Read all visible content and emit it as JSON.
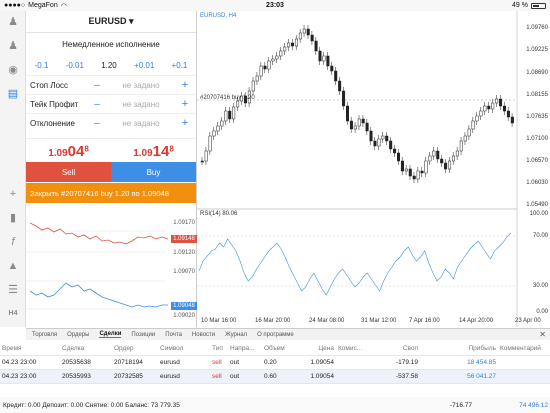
{
  "status": {
    "carrier": "MegaFon",
    "time": "23:03",
    "battery": "49 %"
  },
  "rail_icons": [
    "person-icon",
    "people-icon",
    "chat-icon",
    "new-order-icon",
    "crosshair-icon",
    "candles-icon",
    "function-icon",
    "objects-icon",
    "chart-type-icon",
    "timeframe-icon"
  ],
  "timeframe": "H4",
  "panel": {
    "symbol": "EURUSD ▾",
    "execution": "Немедленное исполнение",
    "volume_steps": [
      "-0.1",
      "-0.01",
      "1.20",
      "+0.01",
      "+0.1"
    ],
    "fields": [
      {
        "label": "Стоп Лосс",
        "value": "не задано"
      },
      {
        "label": "Тейк Профит",
        "value": "не задано"
      },
      {
        "label": "Отклонение",
        "value": "не задано"
      }
    ],
    "sell_price": {
      "main": "1.09",
      "big": "04",
      "sup": "8"
    },
    "buy_price": {
      "main": "1.09",
      "big": "14",
      "sup": "8"
    },
    "sell_label": "Sell",
    "buy_label": "Buy",
    "close_label": "Закрыть #20707416 buy 1.20 по 1.09048",
    "mini_ticks_top": [
      "1.09170",
      "1.09148",
      "1.09120"
    ],
    "mini_ticks_bottom": [
      "1.09070",
      "1.09048",
      "1.09020"
    ]
  },
  "chart": {
    "symbol_label": "EURUSD, H4",
    "order_label": "#20707416 buy 1.20",
    "price_ticks": [
      "1.09760",
      "1.09225",
      "1.08690",
      "1.08155",
      "1.07635",
      "1.07100",
      "1.06570",
      "1.06030",
      "1.05490"
    ],
    "rsi_label": "RSI(14) 80.06",
    "rsi_ticks": [
      "100.00",
      "70.00",
      "30.00",
      "0.00"
    ],
    "dates": [
      "10 Mar 16:00",
      "16 Mar 20:00",
      "24 Mar 08:00",
      "31 Mar 12:00",
      "7 Apr 16:00",
      "14 Apr 20:00",
      "23 Apr 00"
    ]
  },
  "tabs": [
    "Торговля",
    "Ордеры",
    "Сделки",
    "Позиции",
    "Почта",
    "Новости",
    "Журнал",
    "О программе"
  ],
  "active_tab": "Сделки",
  "table": {
    "headers": [
      "Время",
      "Сделка",
      "Ордер",
      "Символ",
      "Тип",
      "Напра...",
      "Объем",
      "Цена",
      "Комис...",
      "Своп",
      "Прибыль",
      "Комментарий"
    ],
    "rows": [
      [
        "04.23 23:00",
        "20535638",
        "20718194",
        "eurusd",
        "sell",
        "out",
        "0.20",
        "1.09054",
        "",
        "-179.19",
        "18 454.85",
        ""
      ],
      [
        "04.23 23:00",
        "20535993",
        "20732585",
        "eurusd",
        "sell",
        "out",
        "0.60",
        "1.09054",
        "",
        "-537.58",
        "56 041.27",
        ""
      ]
    ],
    "footer_text": "Кредит: 0.00 Депозит: 0.00 Снятие: 0.00 Баланс: 73 779.35",
    "footer_swap": "-716.77",
    "footer_profit": "74 496.12"
  },
  "colors": {
    "sell": "#e0523f",
    "buy": "#3f8ee6",
    "close": "#f0900e",
    "accent": "#2f7de1"
  }
}
